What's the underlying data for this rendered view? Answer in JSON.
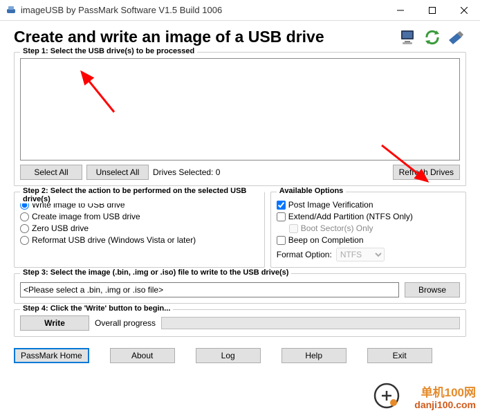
{
  "window": {
    "title": "imageUSB by PassMark Software V1.5 Build 1006"
  },
  "heading": "Create and write an image of a USB drive",
  "step1": {
    "legend": "Step 1:  Select the USB drive(s) to be processed",
    "select_all": "Select All",
    "unselect_all": "Unselect All",
    "drives_selected_label": "Drives Selected: 0",
    "refresh": "Refresh Drives"
  },
  "step2": {
    "legend": "Step 2: Select the action to be performed on the selected USB drive(s)",
    "radios": {
      "write": "Write image to USB drive",
      "create": "Create image from USB drive",
      "zero": "Zero USB drive",
      "reformat": "Reformat USB drive (Windows Vista or later)"
    }
  },
  "options": {
    "legend": "Available Options",
    "post_verify": "Post Image Verification",
    "extend": "Extend/Add Partition (NTFS Only)",
    "boot": "Boot Sector(s) Only",
    "beep": "Beep on Completion",
    "format_label": "Format Option:",
    "format_value": "NTFS"
  },
  "step3": {
    "legend": "Step 3: Select the image (.bin, .img or .iso) file to write to the USB drive(s)",
    "placeholder": "<Please select a .bin, .img or .iso file>",
    "browse": "Browse"
  },
  "step4": {
    "legend": "Step 4: Click the 'Write' button to begin...",
    "write": "Write",
    "progress_label": "Overall progress"
  },
  "footer": {
    "home": "PassMark Home",
    "about": "About",
    "log": "Log",
    "help": "Help",
    "exit": "Exit"
  },
  "watermark": {
    "line1": "单机100网",
    "line2": "danji100.com"
  }
}
